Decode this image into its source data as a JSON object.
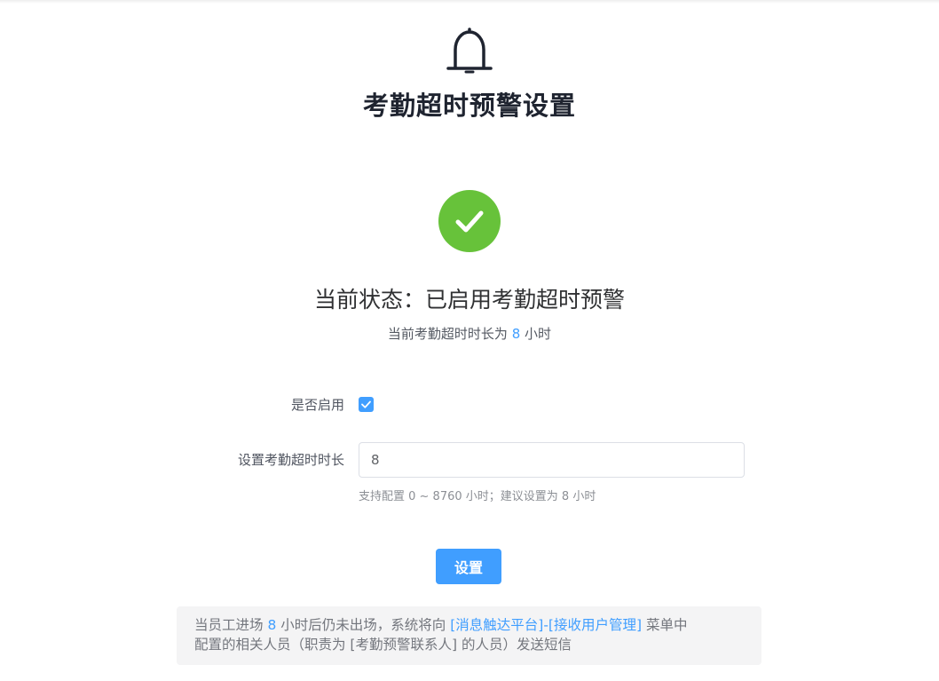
{
  "header": {
    "icon": "bell-icon",
    "title": "考勤超时预警设置"
  },
  "status": {
    "icon": "check-circle-icon",
    "icon_color": "#67c23a",
    "title": "当前状态：已启用考勤超时预警",
    "desc_prefix": "当前考勤超时时长为",
    "hours": "8",
    "desc_suffix": "小时"
  },
  "form": {
    "enabled_label": "是否启用",
    "enabled": true,
    "duration_label": "设置考勤超时时长",
    "duration_value": "8",
    "hint": "支持配置 0 ~ 8760 小时；建议设置为 8 小时"
  },
  "submit_label": "设置",
  "notice": {
    "part1": "当员工进场",
    "hours": "8",
    "part2": "小时后仍未出场，系统将向",
    "link": "[消息触达平台]-[接收用户管理]",
    "part3": "菜单中",
    "line2": "配置的相关人员（职责为 [考勤预警联系人] 的人员）发送短信"
  },
  "colors": {
    "accent": "#409eff",
    "success": "#67c23a"
  }
}
